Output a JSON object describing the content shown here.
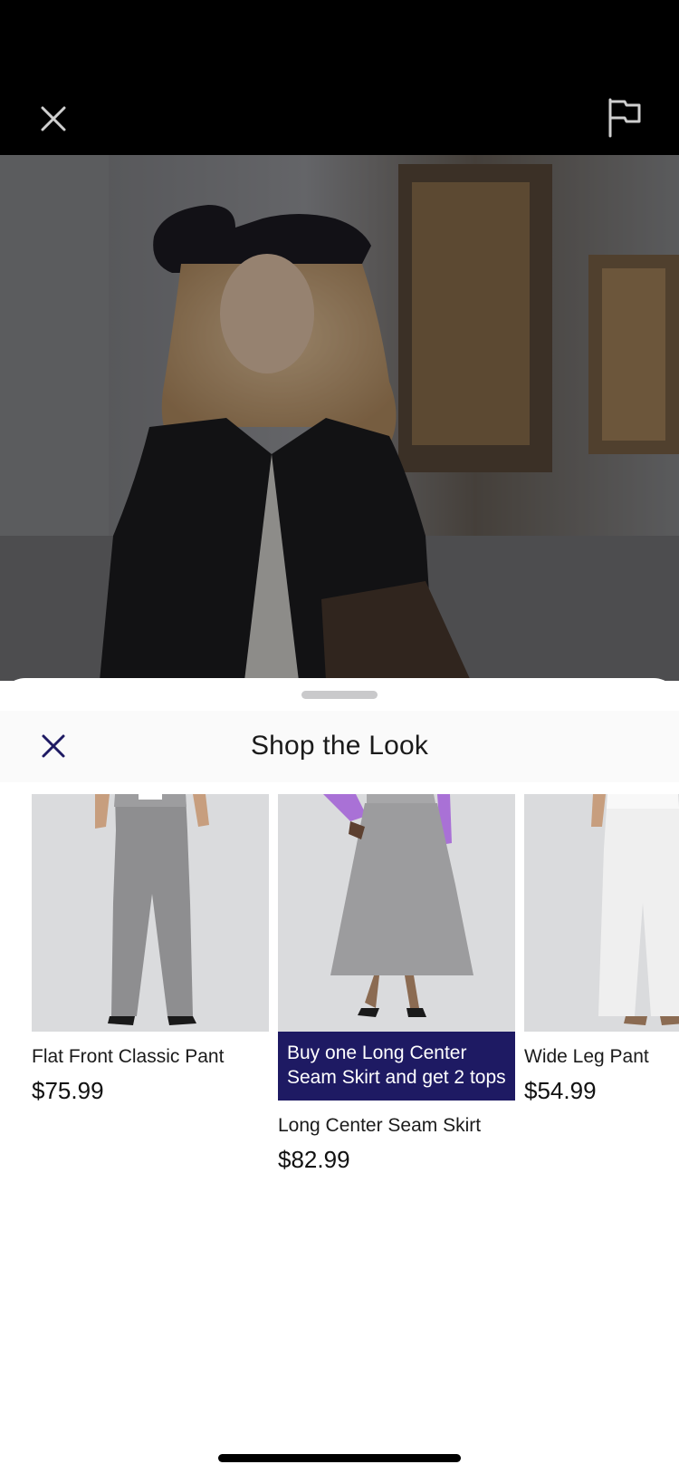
{
  "top_bar": {
    "close_icon": "close-icon",
    "report_icon": "flag-icon"
  },
  "sheet": {
    "title": "Shop the Look",
    "close_icon": "close-icon"
  },
  "products": [
    {
      "name": "Flat Front Classic Pant",
      "price": "$75.99",
      "promo": null
    },
    {
      "name": "Long Center Seam Skirt",
      "price": "$82.99",
      "promo": "Buy one Long Center Seam Skirt and get 2 tops"
    },
    {
      "name": "Wide Leg Pant",
      "price": "$54.99",
      "promo": null
    }
  ],
  "colors": {
    "promo_bg": "#1e1a63",
    "accent": "#1e1a63",
    "top_bar_bg": "#000000"
  }
}
